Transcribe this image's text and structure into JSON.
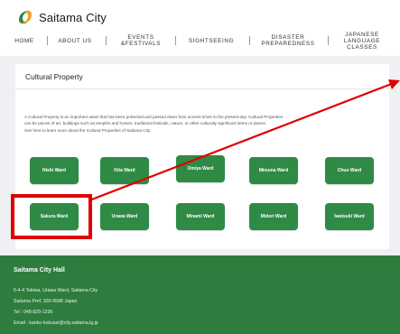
{
  "header": {
    "logo_text": "Saitama City",
    "nav": [
      {
        "label": "HOME"
      },
      {
        "label": "ABOUT US"
      },
      {
        "label": "EVENTS\n&FESTIVALS"
      },
      {
        "label": "SIGHTSEEING"
      },
      {
        "label": "DISASTER\nPREPAREDNESS"
      },
      {
        "label": "JAPANESE\nLANGUAGE\nCLASSES"
      }
    ]
  },
  "main": {
    "title": "Cultural Property",
    "description_lines": [
      "A Cultural Property is an important asset that has been protected and passed down from ancient times to the present day. Cultural Properties",
      "can be pieces of art, buildings such as temples and homes, traditional festivals, nature, or other culturally significant items or places.",
      "See here to learn more about the Cultural Properties of Saitama City."
    ],
    "wards": [
      {
        "label": "Nishi Ward"
      },
      {
        "label": "Kita Ward"
      },
      {
        "label": "Omiya Ward"
      },
      {
        "label": "Minuma Ward"
      },
      {
        "label": "Chuo Ward"
      },
      {
        "label": "Sakura Ward"
      },
      {
        "label": "Urawa Ward"
      },
      {
        "label": "Minami Ward"
      },
      {
        "label": "Midori Ward"
      },
      {
        "label": "Iwatsuki Ward"
      }
    ]
  },
  "footer": {
    "title": "Saitama City Hall",
    "lines": [
      "6-4-4 Tokiwa, Urawa Ward, Saitama City",
      "Saitama Pref. 330-9588 Japan",
      "Tel : 048-829-1236",
      "Email : kanko-kokusai@city.saitama.lg.jp"
    ]
  },
  "colors": {
    "ward_button": "#2f8a45",
    "footer_bg": "#2e7d3e",
    "highlight": "#e00000"
  }
}
